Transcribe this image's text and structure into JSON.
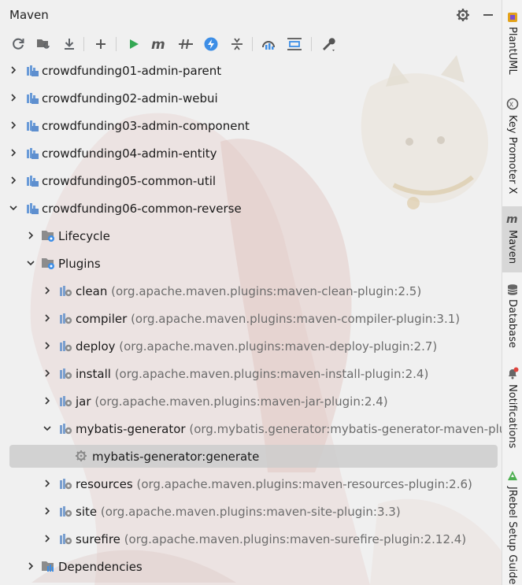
{
  "panel": {
    "title": "Maven",
    "title_icons": [
      "gear-icon",
      "minimize-icon"
    ]
  },
  "toolbar": {
    "buttons": [
      {
        "name": "reload-all-maven-projects-icon"
      },
      {
        "name": "generate-sources-icon"
      },
      {
        "name": "download-sources-icon"
      },
      {
        "name": "add-maven-project-icon"
      },
      {
        "name": "run-maven-build-icon"
      },
      {
        "name": "execute-maven-goal-icon"
      },
      {
        "name": "toggle-offline-mode-icon"
      },
      {
        "name": "skip-tests-icon"
      },
      {
        "name": "show-dependencies-icon"
      },
      {
        "name": "collapse-all-icon"
      },
      {
        "name": "analyze-dependencies-icon"
      },
      {
        "name": "build-tool-settings-icon"
      }
    ]
  },
  "tree": {
    "rows": [
      {
        "label": "crowdfunding01-admin-parent",
        "detail": ""
      },
      {
        "label": "crowdfunding02-admin-webui",
        "detail": ""
      },
      {
        "label": "crowdfunding03-admin-component",
        "detail": ""
      },
      {
        "label": "crowdfunding04-admin-entity",
        "detail": ""
      },
      {
        "label": "crowdfunding05-common-util",
        "detail": ""
      },
      {
        "label": "crowdfunding06-common-reverse",
        "detail": ""
      },
      {
        "label": "Lifecycle",
        "detail": ""
      },
      {
        "label": "Plugins",
        "detail": ""
      },
      {
        "label": "clean",
        "detail": "(org.apache.maven.plugins:maven-clean-plugin:2.5)"
      },
      {
        "label": "compiler",
        "detail": "(org.apache.maven.plugins:maven-compiler-plugin:3.1)"
      },
      {
        "label": "deploy",
        "detail": "(org.apache.maven.plugins:maven-deploy-plugin:2.7)"
      },
      {
        "label": "install",
        "detail": "(org.apache.maven.plugins:maven-install-plugin:2.4)"
      },
      {
        "label": "jar",
        "detail": "(org.apache.maven.plugins:maven-jar-plugin:2.4)"
      },
      {
        "label": "mybatis-generator",
        "detail": "(org.mybatis.generator:mybatis-generator-maven-plug"
      },
      {
        "label": "mybatis-generator:generate",
        "detail": ""
      },
      {
        "label": "resources",
        "detail": "(org.apache.maven.plugins:maven-resources-plugin:2.6)"
      },
      {
        "label": "site",
        "detail": "(org.apache.maven.plugins:maven-site-plugin:3.3)"
      },
      {
        "label": "surefire",
        "detail": "(org.apache.maven.plugins:maven-surefire-plugin:2.12.4)"
      },
      {
        "label": "Dependencies",
        "detail": ""
      }
    ]
  },
  "right_sidebar": {
    "tabs": [
      {
        "label": "PlantUML",
        "icon": "plantuml-icon"
      },
      {
        "label": "Key Promoter X",
        "icon": "key-promoter-icon"
      },
      {
        "label": "Maven",
        "icon": "maven-icon"
      },
      {
        "label": "Database",
        "icon": "database-icon"
      },
      {
        "label": "Notifications",
        "icon": "notifications-icon"
      },
      {
        "label": "JRebel Setup Guide",
        "icon": "jrebel-icon"
      }
    ]
  },
  "colors": {
    "accent": "#3d8ee6",
    "run_green": "#34a853",
    "selection": "#cdcdcd"
  }
}
